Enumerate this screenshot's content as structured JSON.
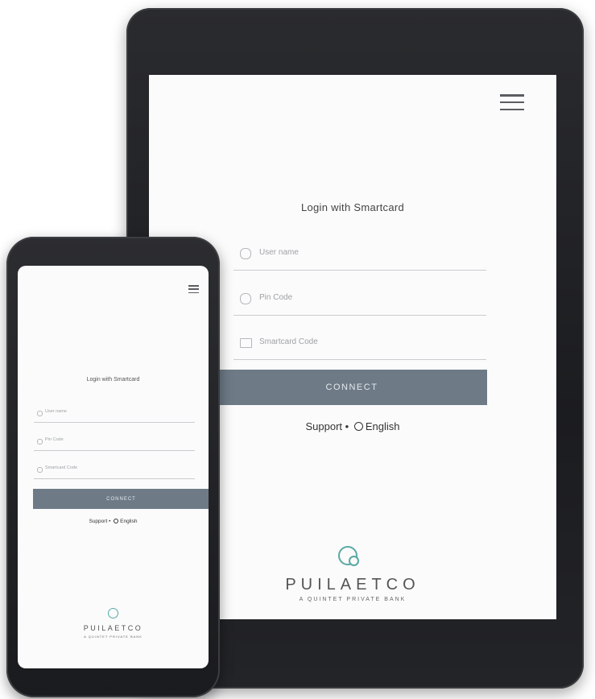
{
  "tablet": {
    "title": "Login with Smartcard",
    "fields": [
      {
        "icon": "user-icon",
        "placeholder": "User name"
      },
      {
        "icon": "lock-icon",
        "placeholder": "Pin Code"
      },
      {
        "icon": "card-icon",
        "placeholder": "Smartcard Code"
      }
    ],
    "connect_label": "CONNECT",
    "support_label": "Support",
    "separator": "•",
    "language_label": "English",
    "logo_name": "PUILAETCO",
    "logo_tagline": "A QUINTET PRIVATE BANK"
  },
  "phone": {
    "title": "Login with Smartcard",
    "fields": [
      {
        "icon": "user-icon",
        "placeholder": "User name"
      },
      {
        "icon": "lock-icon",
        "placeholder": "Pin Code"
      },
      {
        "icon": "card-icon",
        "placeholder": "Smartcard Code"
      }
    ],
    "connect_label": "CONNECT",
    "support_label": "Support",
    "separator": "•",
    "language_label": "English",
    "logo_name": "PUILAETCO",
    "logo_tagline": "A QUINTET PRIVATE BANK"
  },
  "colors": {
    "accent": "#6e7b87",
    "logo": "#58a9a3",
    "device_frame": "#1f2023",
    "screen": "#fbfbfb"
  }
}
